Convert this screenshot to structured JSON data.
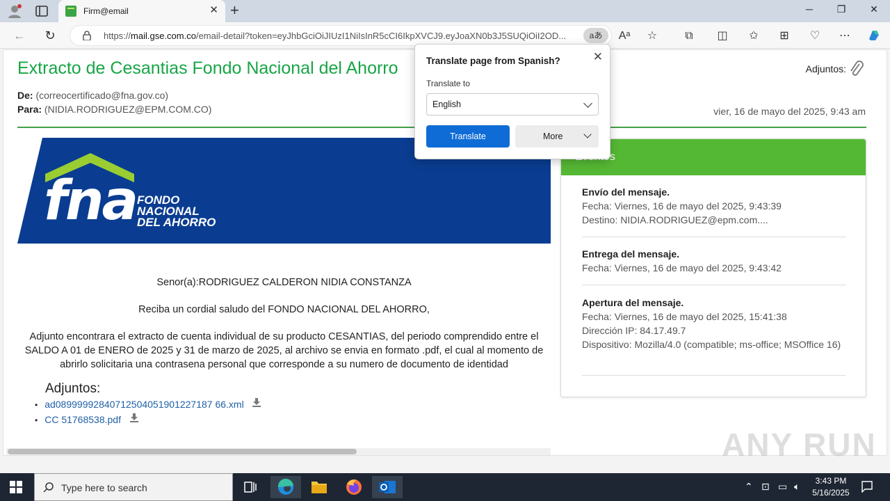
{
  "browser": {
    "tab_title": "Firm@email",
    "url_prefix": "https://",
    "url_host": "mail.gse.com.co",
    "url_rest": "/email-detail?token=eyJhbGciOiJIUzI1NiIsInR5cCI6IkpXVCJ9.eyJoaXN0b3J5SUQiOiI2OD...",
    "translate_badge": "aあ"
  },
  "email": {
    "subject": "Extracto de Cesantias Fondo Nacional del Ahorro",
    "attachments_header": "Adjuntos:",
    "from_label": "De:",
    "from_value": "(correocertificado@fna.gov.co)",
    "to_label": "Para:",
    "to_value": "(NIDIA.RODRIGUEZ@EPM.COM.CO)",
    "date": "vier, 16 de mayo del 2025, 9:43 am",
    "banner_logo": "fna",
    "banner_name_1": "FONDO",
    "banner_name_2": "NACIONAL",
    "banner_name_3": "DEL AHORRO",
    "greeting": "Senor(a):RODRIGUEZ CALDERON NIDIA CONSTANZA",
    "salute": "Reciba un cordial saludo del FONDO NACIONAL DEL AHORRO,",
    "paragraph": "Adjunto encontrara el extracto de cuenta individual de su producto CESANTIAS, del periodo comprendido entre el SALDO A 01 de ENERO de 2025 y 31 de marzo de 2025, al archivo se envia en formato .pdf, el cual al momento de abrirlo solicitaria una contrasena personal que corresponde a su numero de documento de identidad",
    "attachments_title": "Adjuntos:",
    "attachments": [
      "ad08999992840712504051901227187 66.xml",
      "CC 51768538.pdf"
    ]
  },
  "events": {
    "title": "Eventos",
    "items": [
      {
        "title": "Envío del mensaje.",
        "lines": [
          "Fecha: Viernes, 16 de mayo del 2025, 9:43:39",
          "Destino: NIDIA.RODRIGUEZ@epm.com...."
        ]
      },
      {
        "title": "Entrega del mensaje.",
        "lines": [
          "Fecha: Viernes, 16 de mayo del 2025, 9:43:42"
        ]
      },
      {
        "title": "Apertura del mensaje.",
        "lines": [
          "Fecha: Viernes, 16 de mayo del 2025, 15:41:38",
          "Dirección IP: 84.17.49.7",
          "Dispositivo: Mozilla/4.0 (compatible; ms-office; MSOffice 16)"
        ]
      }
    ]
  },
  "translate_popup": {
    "title": "Translate page from Spanish?",
    "label": "Translate to",
    "selected_language": "English",
    "translate_button": "Translate",
    "more_button": "More"
  },
  "watermark": "ANY RUN",
  "taskbar": {
    "search_placeholder": "Type here to search",
    "time": "3:43 PM",
    "date": "5/16/2025"
  },
  "colors": {
    "accent_green": "#18a546",
    "events_header": "#55b834",
    "fna_blue": "#0a3d91",
    "translate_blue": "#0f6cd6"
  }
}
